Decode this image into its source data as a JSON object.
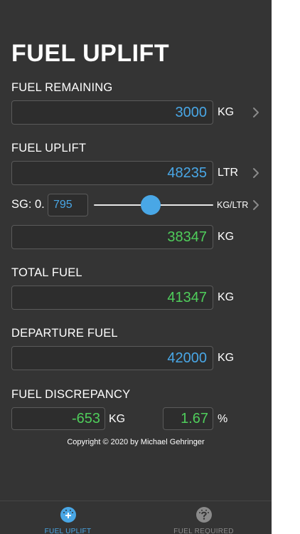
{
  "header": {
    "title": "FUEL UPLIFT"
  },
  "fuel_remaining": {
    "label": "FUEL REMAINING",
    "value": "3000",
    "unit": "KG"
  },
  "fuel_uplift": {
    "label": "FUEL UPLIFT",
    "value": "48235",
    "unit": "LTR"
  },
  "specific_gravity": {
    "label": "SG: 0.",
    "value": "795",
    "slider_level": 0.47,
    "unit": "KG/LTR"
  },
  "uplift_mass": {
    "value": "38347",
    "unit": "KG"
  },
  "total_fuel": {
    "label": "TOTAL FUEL",
    "value": "41347",
    "unit": "KG"
  },
  "departure_fuel": {
    "label": "DEPARTURE FUEL",
    "value": "42000",
    "unit": "KG"
  },
  "discrepancy": {
    "label": "FUEL DISCREPANCY",
    "kg_value": "-653",
    "kg_unit": "KG",
    "pct_value": "1.67",
    "pct_unit": "%"
  },
  "copyright": "Copyright © 2020 by Michael Gehringer",
  "tabs": [
    {
      "label": "FUEL UPLIFT",
      "icon": "fuel-gauge-plus-icon",
      "active": true
    },
    {
      "label": "FUEL REQUIRED",
      "icon": "fuel-gauge-question-icon",
      "active": false
    }
  ],
  "colors": {
    "accent": "#49a7e6",
    "positive": "#4fcd5b",
    "background": "#343434"
  }
}
